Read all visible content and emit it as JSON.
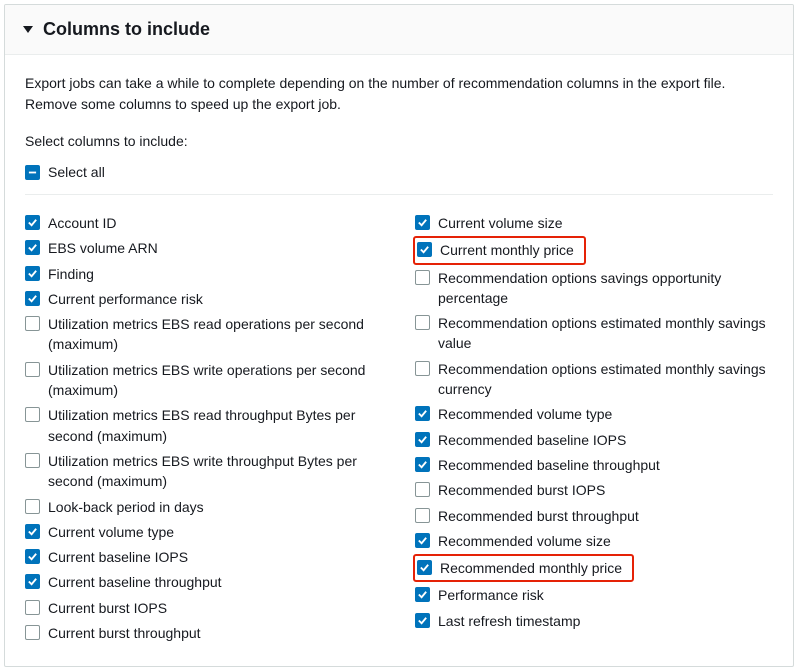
{
  "panel": {
    "title": "Columns to include",
    "description": "Export jobs can take a while to complete depending on the number of recommendation columns in the export file. Remove some columns to speed up the export job.",
    "subhead": "Select columns to include:",
    "select_all_label": "Select all",
    "select_all_state": "indeterminate"
  },
  "columns": {
    "left": [
      {
        "label": "Account ID",
        "checked": true,
        "highlight": false
      },
      {
        "label": "EBS volume ARN",
        "checked": true,
        "highlight": false
      },
      {
        "label": "Finding",
        "checked": true,
        "highlight": false
      },
      {
        "label": "Current performance risk",
        "checked": true,
        "highlight": false
      },
      {
        "label": "Utilization metrics EBS read operations per second (maximum)",
        "checked": false,
        "highlight": false
      },
      {
        "label": "Utilization metrics EBS write operations per second (maximum)",
        "checked": false,
        "highlight": false
      },
      {
        "label": "Utilization metrics EBS read throughput Bytes per second (maximum)",
        "checked": false,
        "highlight": false
      },
      {
        "label": "Utilization metrics EBS write throughput Bytes per second (maximum)",
        "checked": false,
        "highlight": false
      },
      {
        "label": "Look-back period in days",
        "checked": false,
        "highlight": false
      },
      {
        "label": "Current volume type",
        "checked": true,
        "highlight": false
      },
      {
        "label": "Current baseline IOPS",
        "checked": true,
        "highlight": false
      },
      {
        "label": "Current baseline throughput",
        "checked": true,
        "highlight": false
      },
      {
        "label": "Current burst IOPS",
        "checked": false,
        "highlight": false
      },
      {
        "label": "Current burst throughput",
        "checked": false,
        "highlight": false
      }
    ],
    "right": [
      {
        "label": "Current volume size",
        "checked": true,
        "highlight": false
      },
      {
        "label": "Current monthly price",
        "checked": true,
        "highlight": true
      },
      {
        "label": "Recommendation options savings opportunity percentage",
        "checked": false,
        "highlight": false
      },
      {
        "label": "Recommendation options estimated monthly savings value",
        "checked": false,
        "highlight": false
      },
      {
        "label": "Recommendation options estimated monthly savings currency",
        "checked": false,
        "highlight": false
      },
      {
        "label": "Recommended volume type",
        "checked": true,
        "highlight": false
      },
      {
        "label": "Recommended baseline IOPS",
        "checked": true,
        "highlight": false
      },
      {
        "label": "Recommended baseline throughput",
        "checked": true,
        "highlight": false
      },
      {
        "label": "Recommended burst IOPS",
        "checked": false,
        "highlight": false
      },
      {
        "label": "Recommended burst throughput",
        "checked": false,
        "highlight": false
      },
      {
        "label": "Recommended volume size",
        "checked": true,
        "highlight": false
      },
      {
        "label": "Recommended monthly price",
        "checked": true,
        "highlight": true
      },
      {
        "label": "Performance risk",
        "checked": true,
        "highlight": false
      },
      {
        "label": "Last refresh timestamp",
        "checked": true,
        "highlight": false
      }
    ]
  },
  "colors": {
    "accent": "#0073bb",
    "highlight_border": "#e52207"
  }
}
